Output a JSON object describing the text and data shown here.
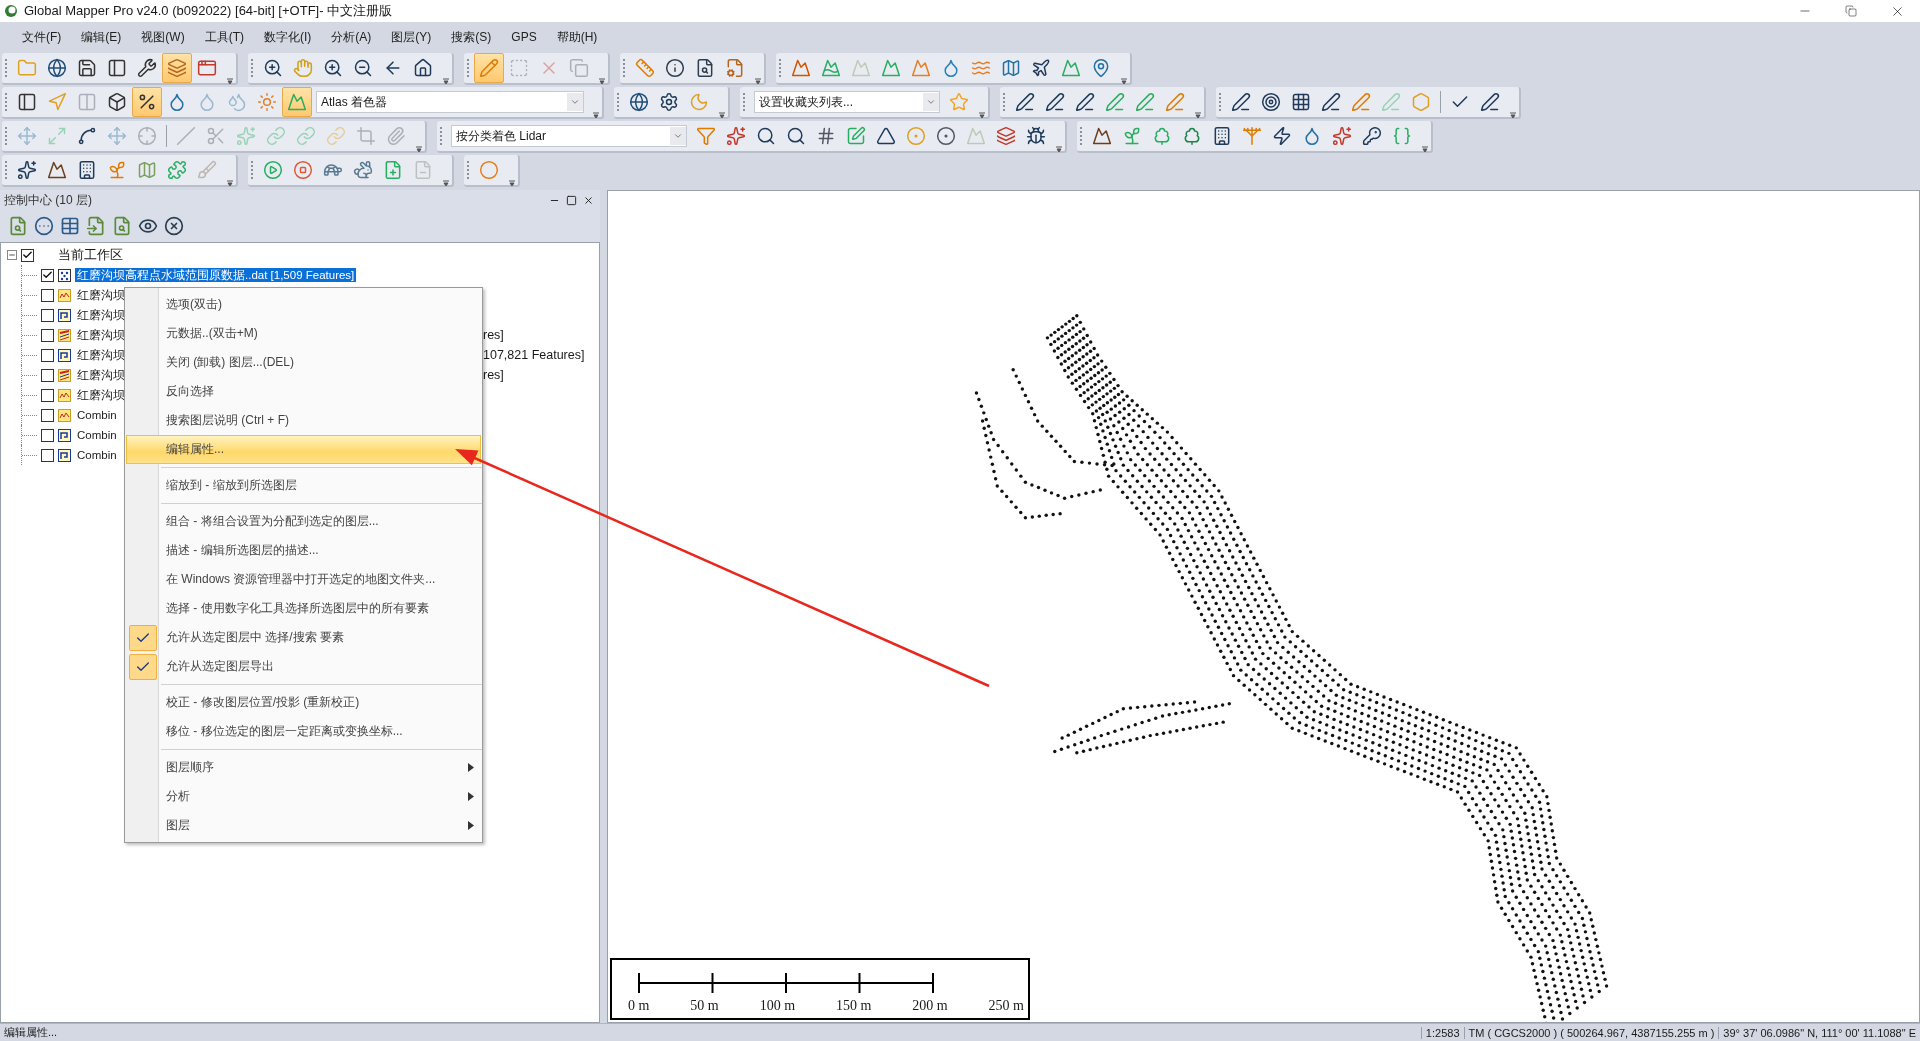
{
  "window": {
    "title": "Global Mapper Pro v24.0 (b092022) [64-bit] [+OTF]- 中文注册版"
  },
  "menu_bar": [
    "文件(F)",
    "编辑(E)",
    "视图(W)",
    "工具(T)",
    "数字化(I)",
    "分析(A)",
    "图层(Y)",
    "搜索(S)",
    "GPS",
    "帮助(H)"
  ],
  "toolbar_rows": [
    [
      {
        "items": [
          {
            "kind": "button",
            "pressed": false,
            "disabled": false
          },
          {
            "kind": "button",
            "pressed": false,
            "disabled": false
          },
          {
            "kind": "button",
            "pressed": false,
            "disabled": false
          },
          {
            "kind": "button",
            "pressed": false,
            "disabled": false
          },
          {
            "kind": "button",
            "pressed": false,
            "disabled": false
          },
          {
            "kind": "button",
            "pressed": true,
            "disabled": false
          },
          {
            "kind": "button",
            "pressed": false,
            "disabled": false
          }
        ]
      },
      {
        "items": [
          {
            "kind": "button",
            "pressed": false,
            "disabled": false
          },
          {
            "kind": "button",
            "pressed": false,
            "disabled": false
          },
          {
            "kind": "button",
            "pressed": false,
            "disabled": false
          },
          {
            "kind": "button",
            "pressed": false,
            "disabled": false
          },
          {
            "kind": "button",
            "pressed": false,
            "disabled": false
          },
          {
            "kind": "button",
            "pressed": false,
            "disabled": false
          }
        ]
      },
      {
        "items": [
          {
            "kind": "button",
            "pressed": true,
            "disabled": false
          },
          {
            "kind": "button",
            "pressed": false,
            "disabled": true
          },
          {
            "kind": "button",
            "pressed": false,
            "disabled": true
          },
          {
            "kind": "button",
            "pressed": false,
            "disabled": true
          }
        ]
      },
      {
        "items": [
          {
            "kind": "button",
            "pressed": false,
            "disabled": false
          },
          {
            "kind": "button",
            "pressed": false,
            "disabled": false
          },
          {
            "kind": "button",
            "pressed": false,
            "disabled": false
          },
          {
            "kind": "button",
            "pressed": false,
            "disabled": false
          }
        ]
      },
      {
        "items": [
          {
            "kind": "button",
            "pressed": false,
            "disabled": false
          },
          {
            "kind": "button",
            "pressed": false,
            "disabled": false
          },
          {
            "kind": "button",
            "pressed": false,
            "disabled": true
          },
          {
            "kind": "button",
            "pressed": false,
            "disabled": false
          },
          {
            "kind": "button",
            "pressed": false,
            "disabled": false
          },
          {
            "kind": "button",
            "pressed": false,
            "disabled": false
          },
          {
            "kind": "button",
            "pressed": false,
            "disabled": false
          },
          {
            "kind": "button",
            "pressed": false,
            "disabled": false
          },
          {
            "kind": "button",
            "pressed": false,
            "disabled": false
          },
          {
            "kind": "button",
            "pressed": false,
            "disabled": false
          },
          {
            "kind": "button",
            "pressed": false,
            "disabled": false
          }
        ]
      }
    ],
    [
      {
        "items": [
          {
            "kind": "button",
            "pressed": false,
            "disabled": false
          },
          {
            "kind": "button",
            "pressed": false,
            "disabled": false
          },
          {
            "kind": "button",
            "pressed": false,
            "disabled": true
          },
          {
            "kind": "button",
            "pressed": false,
            "disabled": false
          },
          {
            "kind": "button",
            "pressed": true,
            "disabled": false
          },
          {
            "kind": "button",
            "pressed": false,
            "disabled": false
          },
          {
            "kind": "button",
            "pressed": false,
            "disabled": true
          },
          {
            "kind": "button",
            "pressed": false,
            "disabled": true
          },
          {
            "kind": "button",
            "pressed": false,
            "disabled": false
          },
          {
            "kind": "button",
            "pressed": true,
            "disabled": false
          },
          {
            "kind": "dropdown",
            "value": "Atlas 着色器"
          }
        ]
      },
      {
        "items": [
          {
            "kind": "button",
            "pressed": false,
            "disabled": false
          },
          {
            "kind": "button",
            "pressed": false,
            "disabled": false
          },
          {
            "kind": "button",
            "pressed": false,
            "disabled": false
          }
        ]
      },
      {
        "items": [
          {
            "kind": "dropdown",
            "value": "设置收藏夹列表..."
          },
          {
            "kind": "button",
            "pressed": false,
            "disabled": false
          }
        ]
      },
      {
        "items": [
          {
            "kind": "button",
            "pressed": false,
            "disabled": false
          },
          {
            "kind": "button",
            "pressed": false,
            "disabled": false
          },
          {
            "kind": "button",
            "pressed": false,
            "disabled": false
          },
          {
            "kind": "button",
            "pressed": false,
            "disabled": false
          },
          {
            "kind": "button",
            "pressed": false,
            "disabled": false
          },
          {
            "kind": "button",
            "pressed": false,
            "disabled": false
          }
        ]
      },
      {
        "items": [
          {
            "kind": "button",
            "pressed": false,
            "disabled": false
          },
          {
            "kind": "button",
            "pressed": false,
            "disabled": false
          },
          {
            "kind": "button",
            "pressed": false,
            "disabled": false
          },
          {
            "kind": "button",
            "pressed": false,
            "disabled": false
          },
          {
            "kind": "button",
            "pressed": false,
            "disabled": false
          },
          {
            "kind": "button",
            "pressed": false,
            "disabled": true
          },
          {
            "kind": "button",
            "pressed": false,
            "disabled": false
          },
          {
            "kind": "separator"
          },
          {
            "kind": "button",
            "pressed": false,
            "disabled": false
          },
          {
            "kind": "button",
            "pressed": false,
            "disabled": false
          }
        ]
      }
    ],
    [
      {
        "items": [
          {
            "kind": "button",
            "pressed": false,
            "disabled": true
          },
          {
            "kind": "button",
            "pressed": false,
            "disabled": true
          },
          {
            "kind": "button",
            "pressed": false,
            "disabled": false
          },
          {
            "kind": "button",
            "pressed": false,
            "disabled": true
          },
          {
            "kind": "button",
            "pressed": false,
            "disabled": true
          },
          {
            "kind": "separator"
          },
          {
            "kind": "button",
            "pressed": false,
            "disabled": true
          },
          {
            "kind": "button",
            "pressed": false,
            "disabled": true
          },
          {
            "kind": "button",
            "pressed": false,
            "disabled": true
          },
          {
            "kind": "button",
            "pressed": false,
            "disabled": true
          },
          {
            "kind": "button",
            "pressed": false,
            "disabled": true
          },
          {
            "kind": "button",
            "pressed": false,
            "disabled": true
          },
          {
            "kind": "button",
            "pressed": false,
            "disabled": true
          },
          {
            "kind": "button",
            "pressed": false,
            "disabled": true
          }
        ]
      },
      {
        "items": [
          {
            "kind": "dropdown",
            "value": "按分类着色 Lidar"
          },
          {
            "kind": "button",
            "pressed": false,
            "disabled": false
          },
          {
            "kind": "button",
            "pressed": false,
            "disabled": false
          },
          {
            "kind": "button",
            "pressed": false,
            "disabled": false
          },
          {
            "kind": "button",
            "pressed": false,
            "disabled": false
          },
          {
            "kind": "button",
            "pressed": false,
            "disabled": false
          },
          {
            "kind": "button",
            "pressed": false,
            "disabled": false
          },
          {
            "kind": "button",
            "pressed": false,
            "disabled": false
          },
          {
            "kind": "button",
            "pressed": false,
            "disabled": false
          },
          {
            "kind": "button",
            "pressed": false,
            "disabled": false
          },
          {
            "kind": "button",
            "pressed": false,
            "disabled": true
          },
          {
            "kind": "button",
            "pressed": false,
            "disabled": false
          },
          {
            "kind": "button",
            "pressed": false,
            "disabled": false
          }
        ]
      },
      {
        "items": [
          {
            "kind": "button",
            "pressed": false,
            "disabled": false
          },
          {
            "kind": "button",
            "pressed": false,
            "disabled": false
          },
          {
            "kind": "button",
            "pressed": false,
            "disabled": false
          },
          {
            "kind": "button",
            "pressed": false,
            "disabled": false
          },
          {
            "kind": "button",
            "pressed": false,
            "disabled": false
          },
          {
            "kind": "button",
            "pressed": false,
            "disabled": false
          },
          {
            "kind": "button",
            "pressed": false,
            "disabled": false
          },
          {
            "kind": "button",
            "pressed": false,
            "disabled": false
          },
          {
            "kind": "button",
            "pressed": false,
            "disabled": false
          },
          {
            "kind": "button",
            "pressed": false,
            "disabled": false
          },
          {
            "kind": "button",
            "pressed": false,
            "disabled": false
          }
        ]
      }
    ],
    [
      {
        "items": [
          {
            "kind": "button",
            "pressed": false,
            "disabled": false
          },
          {
            "kind": "button",
            "pressed": false,
            "disabled": false
          },
          {
            "kind": "button",
            "pressed": false,
            "disabled": false
          },
          {
            "kind": "button",
            "pressed": false,
            "disabled": false
          },
          {
            "kind": "button",
            "pressed": false,
            "disabled": false
          },
          {
            "kind": "button",
            "pressed": false,
            "disabled": false
          },
          {
            "kind": "button",
            "pressed": false,
            "disabled": true
          }
        ]
      },
      {
        "items": [
          {
            "kind": "button",
            "pressed": false,
            "disabled": false
          },
          {
            "kind": "button",
            "pressed": false,
            "disabled": false
          },
          {
            "kind": "button",
            "pressed": false,
            "disabled": false
          },
          {
            "kind": "button",
            "pressed": false,
            "disabled": false
          },
          {
            "kind": "button",
            "pressed": false,
            "disabled": false
          },
          {
            "kind": "button",
            "pressed": false,
            "disabled": true
          }
        ]
      },
      {
        "items": [
          {
            "kind": "button",
            "pressed": false,
            "disabled": false
          }
        ]
      }
    ]
  ],
  "control_center": {
    "title": "控制中心 (10 层)",
    "root": {
      "label": "当前工作区",
      "checked": true,
      "expanded": true,
      "children": [
        {
          "label": "红磨沟坝高程点水域范围原数据..dat [1,509 Features]",
          "kind": "points",
          "checked": true,
          "selected": true
        },
        {
          "label": "红磨沟坝",
          "kind": "raster",
          "checked": false,
          "selected": false
        },
        {
          "label": "红磨沟坝",
          "kind": "vector",
          "checked": false,
          "selected": false
        },
        {
          "label": "红磨沟坝",
          "kind": "contour",
          "checked": false,
          "selected": false,
          "tail": "res]"
        },
        {
          "label": "红磨沟坝",
          "kind": "vector",
          "checked": false,
          "selected": false,
          "tail": "107,821 Features]"
        },
        {
          "label": "红磨沟坝",
          "kind": "contour",
          "checked": false,
          "selected": false,
          "tail": "res]"
        },
        {
          "label": "红磨沟坝",
          "kind": "raster",
          "checked": false,
          "selected": false
        },
        {
          "label": "Combin",
          "kind": "raster",
          "checked": false,
          "selected": false
        },
        {
          "label": "Combin",
          "kind": "vector",
          "checked": false,
          "selected": false
        },
        {
          "label": "Combin",
          "kind": "vector",
          "checked": false,
          "selected": false
        }
      ]
    }
  },
  "context_menu": [
    {
      "kind": "item",
      "label": "选项(双击)",
      "selected": false,
      "checked": false
    },
    {
      "kind": "item",
      "label": "元数据..(双击+M)",
      "selected": false,
      "checked": false
    },
    {
      "kind": "item",
      "label": "关闭 (卸载) 图层...(DEL)",
      "selected": false,
      "checked": false
    },
    {
      "kind": "item",
      "label": "反向选择",
      "selected": false,
      "checked": false
    },
    {
      "kind": "item",
      "label": "搜索图层说明 (Ctrl + F)",
      "selected": false,
      "checked": false
    },
    {
      "kind": "item",
      "label": "编辑属性...",
      "selected": true,
      "checked": false
    },
    {
      "kind": "separator"
    },
    {
      "kind": "item",
      "label": "缩放到 - 缩放到所选图层",
      "selected": false,
      "checked": false
    },
    {
      "kind": "separator"
    },
    {
      "kind": "item",
      "label": "组合 - 将组合设置为分配到选定的图层...",
      "selected": false,
      "checked": false
    },
    {
      "kind": "item",
      "label": "描述 - 编辑所选图层的描述...",
      "selected": false,
      "checked": false
    },
    {
      "kind": "item",
      "label": "在 Windows 资源管理器中打开选定的地图文件夹...",
      "selected": false,
      "checked": false
    },
    {
      "kind": "item",
      "label": "选择 - 使用数字化工具选择所选图层中的所有要素",
      "selected": false,
      "checked": false
    },
    {
      "kind": "item",
      "label": "允许从选定图层中 选择/搜索 要素",
      "selected": false,
      "checked": true
    },
    {
      "kind": "item",
      "label": "允许从选定图层导出",
      "selected": false,
      "checked": true
    },
    {
      "kind": "separator"
    },
    {
      "kind": "item",
      "label": "校正 - 修改图层位置/投影 (重新校正)",
      "selected": false,
      "checked": false
    },
    {
      "kind": "item",
      "label": "移位 - 移位选定的图层一定距离或变换坐标...",
      "selected": false,
      "checked": false
    },
    {
      "kind": "separator"
    },
    {
      "kind": "submenu",
      "label": "图层顺序",
      "selected": false,
      "checked": false
    },
    {
      "kind": "submenu",
      "label": "分析",
      "selected": false,
      "checked": false
    },
    {
      "kind": "submenu",
      "label": "图层",
      "selected": false,
      "checked": false
    }
  ],
  "scale_bar": {
    "labels": [
      "0 m",
      "50 m",
      "100 m",
      "150 m",
      "200 m",
      "250 m"
    ]
  },
  "status_bar": {
    "message": "编辑属性...",
    "scale": "1:2583",
    "projection": "TM ( CGCS2000 ) ( 500264.967, 4387155.255 m )",
    "coordinates": "39° 37' 06.0986\" N, 111° 00' 11.1088\" E"
  }
}
